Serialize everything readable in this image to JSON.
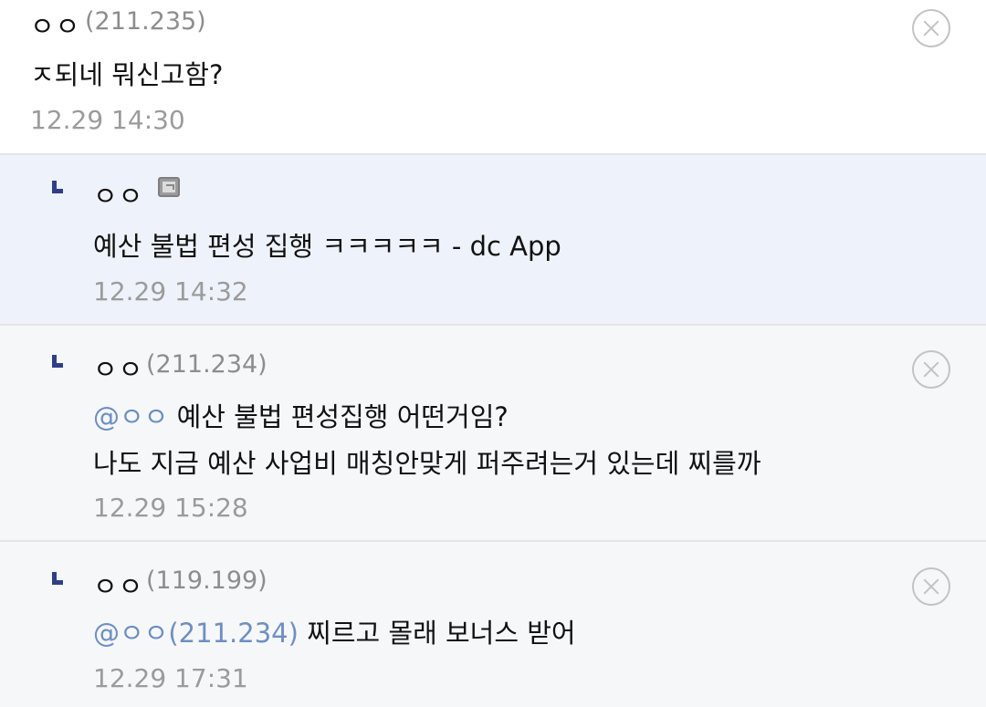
{
  "comments": [
    {
      "nickname": "ㅇㅇ",
      "ip": "(211.235)",
      "body_lines": [
        "ㅈ되네 뭐신고함?"
      ],
      "time": "12.29 14:30",
      "is_reply": false,
      "delete_icon": "close-circle-icon"
    },
    {
      "nickname": "ㅇㅇ",
      "badge_icon": "mobile-app-icon",
      "body_lines": [
        "예산 불법 편성 집행 ㅋㅋㅋㅋㅋ - dc App"
      ],
      "time": "12.29 14:32",
      "is_reply": true
    },
    {
      "nickname": "ㅇㅇ",
      "ip": "(211.234)",
      "mention": "@ㅇㅇ",
      "body_lines": [
        " 예산 불법 편성집행 어떤거임?",
        "나도 지금 예산 사업비 매칭안맞게 퍼주려는거 있는데 찌를까"
      ],
      "time": "12.29 15:28",
      "is_reply": true,
      "delete_icon": "close-circle-icon"
    },
    {
      "nickname": "ㅇㅇ",
      "ip": "(119.199)",
      "mention": "@ㅇㅇ(211.234)",
      "body_lines": [
        " 찌르고 몰래 보너스 받어"
      ],
      "time": "12.29 17:31",
      "is_reply": true,
      "delete_icon": "close-circle-icon"
    }
  ],
  "colors": {
    "reply_background": "#eef2fa",
    "nested_background": "#f6f7f9",
    "mention": "#6e8fc0",
    "reply_marker": "#2f3f86",
    "meta_gray": "#9b9b9b"
  }
}
